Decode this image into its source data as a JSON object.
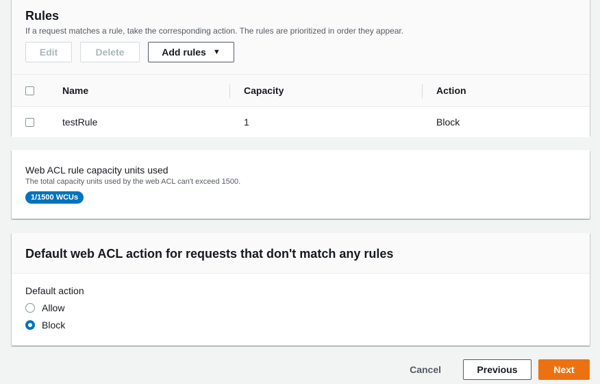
{
  "rules": {
    "title": "Rules",
    "description": "If a request matches a rule, take the corresponding action. The rules are prioritized in order they appear.",
    "buttons": {
      "edit": "Edit",
      "delete": "Delete",
      "add_rules": "Add rules"
    },
    "columns": {
      "name": "Name",
      "capacity": "Capacity",
      "action": "Action"
    },
    "rows": [
      {
        "name": "testRule",
        "capacity": "1",
        "action": "Block"
      }
    ]
  },
  "capacity": {
    "title": "Web ACL rule capacity units used",
    "description": "The total capacity units used by the web ACL can't exceed 1500.",
    "badge": "1/1500 WCUs"
  },
  "default_action": {
    "title": "Default web ACL action for requests that don't match any rules",
    "label": "Default action",
    "options": [
      {
        "label": "Allow",
        "selected": false
      },
      {
        "label": "Block",
        "selected": true
      }
    ]
  },
  "footer": {
    "cancel": "Cancel",
    "previous": "Previous",
    "next": "Next"
  },
  "colors": {
    "accent": "#ec7211",
    "badge": "#0073bb"
  },
  "icons": {
    "add_rules_caret": "caret-down-icon"
  }
}
